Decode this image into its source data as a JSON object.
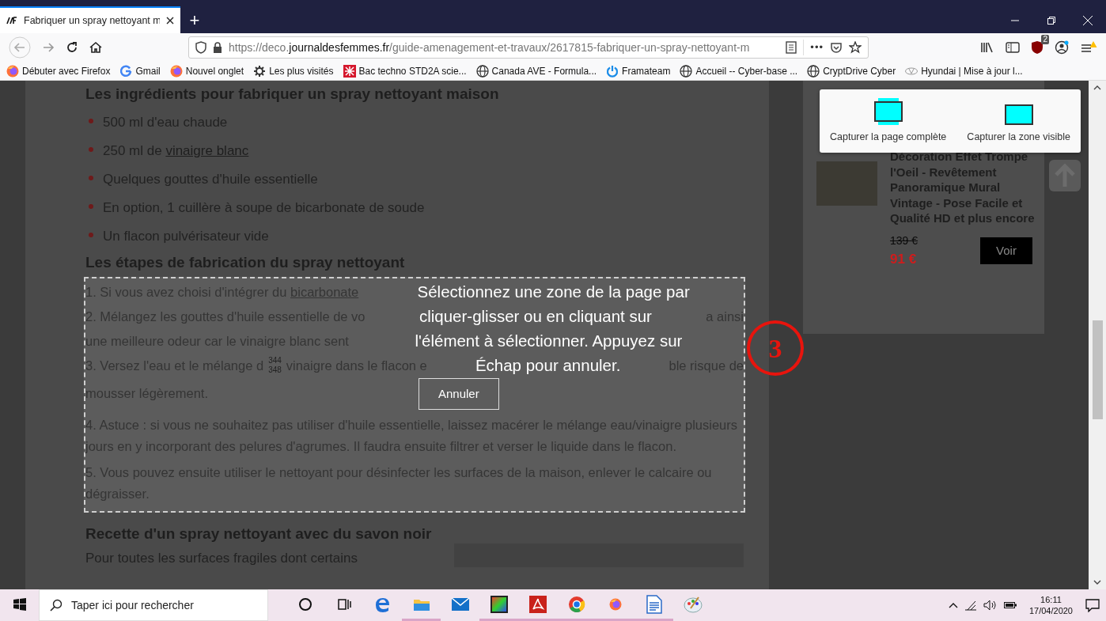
{
  "browser": {
    "tabs": [
      {
        "title": "Fabriquer un spray nettoyant m",
        "selected": true
      }
    ],
    "new_tab": "+",
    "url": {
      "prefix": "https://deco.",
      "domain": "journaldesfemmes.fr",
      "path": "/guide-amenagement-et-travaux/2617815-fabriquer-un-spray-nettoyant-m"
    },
    "more": "•••",
    "extension_badge": "2",
    "bookmarks": [
      {
        "label": "Débuter avec Firefox",
        "kind": "firefox"
      },
      {
        "label": "Gmail",
        "kind": "google"
      },
      {
        "label": "Nouvel onglet",
        "kind": "firefox"
      },
      {
        "label": "Les plus visités",
        "kind": "gear"
      },
      {
        "label": "Bac techno STD2A scie...",
        "kind": "pattern"
      },
      {
        "label": "Canada AVE - Formula...",
        "kind": "globe"
      },
      {
        "label": "Framateam",
        "kind": "power"
      },
      {
        "label": "Accueil -- Cyber-base ...",
        "kind": "globe"
      },
      {
        "label": "CryptDrive Cyber",
        "kind": "globe"
      },
      {
        "label": "Hyundai | Mise à jour l...",
        "kind": "car"
      }
    ]
  },
  "article": [
    {
      "kind": "heading",
      "text": "Les ingrédients pour fabriquer un spray nettoyant maison"
    },
    {
      "kind": "bullets",
      "items": [
        {
          "text": "500 ml d'eau chaude"
        },
        {
          "text": "250 ml de ",
          "link": "vinaigre blanc"
        },
        {
          "text": "Quelques gouttes d'huile essentielle"
        },
        {
          "text": "En option, 1 cuillère à soupe de bicarbonate de soude"
        },
        {
          "text": "Un flacon pulvérisateur vide"
        }
      ]
    },
    {
      "kind": "heading",
      "text": "Les étapes de fabrication du spray nettoyant"
    },
    {
      "kind": "selection",
      "rows": [
        {
          "segments": [
            {
              "kind": "text",
              "text": "1. Si vous avez choisi d'intégrer du "
            },
            {
              "kind": "link",
              "text": "bicarbonate"
            },
            {
              "kind": "message",
              "text": "Sélectionnez une zone de la page par"
            }
          ]
        },
        {
          "segments": [
            {
              "kind": "text",
              "text": "2. Mélangez les gouttes d'huile essentielle de vo"
            },
            {
              "kind": "message",
              "text": "cliquer-glisser ou en cliquant sur"
            },
            {
              "kind": "text",
              "text": "a ainsi"
            }
          ]
        },
        {
          "segments": [
            {
              "kind": "text",
              "text": "une meilleure odeur car le vinaigre blanc sent"
            },
            {
              "kind": "message",
              "text": "l'élément à sélectionner. Appuyez sur"
            }
          ]
        },
        {
          "segments": [
            {
              "kind": "text",
              "text": "3. Versez l'eau et le mélange d"
            },
            {
              "kind": "readout",
              "lines": [
                "344",
                "348"
              ]
            },
            {
              "kind": "text",
              "text": "vinaigre dans le flacon e"
            },
            {
              "kind": "message",
              "text": "Échap pour annuler."
            },
            {
              "kind": "text",
              "text": "ble risque de"
            }
          ]
        },
        {
          "segments": [
            {
              "kind": "text",
              "text": "mousser légèrement."
            },
            {
              "kind": "button",
              "text": "Annuler"
            }
          ]
        }
      ],
      "paragraphs": [
        "4. Astuce : si vous ne souhaitez pas utiliser d'huile essentielle, laissez macérer le mélange eau/vinaigre plusieurs jours en y incorporant des pelures d'agrumes. Il faudra ensuite filtrer et verser le liquide dans le flacon.",
        "5. Vous pouvez ensuite utiliser le nettoyant pour désinfecter les surfaces de la maison, enlever le calcaire ou dégraisser."
      ]
    },
    {
      "kind": "heading",
      "text": "Recette d'un spray nettoyant avec du savon noir"
    },
    {
      "kind": "paragraph",
      "text": "Pour toutes les surfaces fragiles dont certains"
    }
  ],
  "capture_menu": [
    {
      "label": "Capturer la page complète",
      "kind": "full"
    },
    {
      "label": "Capturer la zone visible",
      "kind": "visible"
    }
  ],
  "product": {
    "title": "Décoration Effet Trompe l'Oeil - Revêtement Panoramique Mural Vintage - Pose Facile et Qualité HD et plus encore",
    "old_price": "139 €",
    "price": "91 €",
    "button": "Voir"
  },
  "annotation": "3",
  "taskbar": {
    "search_placeholder": "Taper ici pour rechercher",
    "apps": [
      {
        "kind": "circle",
        "running": false
      },
      {
        "kind": "taskview",
        "running": false
      },
      {
        "kind": "edge",
        "running": false
      },
      {
        "kind": "folder",
        "running": true
      },
      {
        "kind": "mail",
        "running": false
      },
      {
        "kind": "film",
        "running": true
      },
      {
        "kind": "pdf",
        "running": true
      },
      {
        "kind": "chrome",
        "running": true
      },
      {
        "kind": "firefox",
        "running": true
      },
      {
        "kind": "writer",
        "running": true
      },
      {
        "kind": "paint",
        "running": false
      }
    ],
    "time": "16:11",
    "date": "17/04/2020"
  }
}
